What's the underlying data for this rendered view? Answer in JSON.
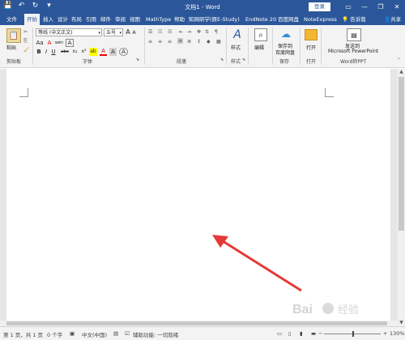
{
  "window": {
    "title": "文档1 - Word",
    "login_label": "登录",
    "minimize": "—",
    "restore": "❐",
    "close": "✕"
  },
  "qat": {
    "save_icon": "💾",
    "undo_icon": "↶",
    "redo_icon": "↻",
    "more_icon": "▾"
  },
  "tabs": [
    {
      "label": "文件"
    },
    {
      "label": "开始"
    },
    {
      "label": "插入"
    },
    {
      "label": "设计"
    },
    {
      "label": "布局"
    },
    {
      "label": "引用"
    },
    {
      "label": "邮件"
    },
    {
      "label": "审阅"
    },
    {
      "label": "视图"
    },
    {
      "label": "MathType"
    },
    {
      "label": "帮助"
    },
    {
      "label": "知网研学(原E-Study)"
    },
    {
      "label": "EndNote 20"
    },
    {
      "label": "百度网盘"
    },
    {
      "label": "NoteExpress"
    }
  ],
  "tellme": "告诉我",
  "share": "共享",
  "ribbon": {
    "clipboard": {
      "paste": "粘贴",
      "label": "剪贴板"
    },
    "font": {
      "font_name": "等线 (中文正文)",
      "font_size": "五号",
      "label": "字体",
      "grow": "A",
      "shrink": "A",
      "aa": "Aa",
      "clear": "A",
      "wen": "wén",
      "A_box": "A",
      "bold": "B",
      "italic": "I",
      "underline": "U",
      "strike": "abc",
      "sub": "x₂",
      "sup": "x²",
      "highlight": "ab",
      "font_color": "A",
      "shade": "A",
      "encircle": "A"
    },
    "paragraph": {
      "label": "段落"
    },
    "styles": {
      "btn": "样式",
      "label": "样式"
    },
    "editing": {
      "btn": "编辑"
    },
    "save": {
      "btn_line1": "保存到",
      "btn_line2": "百度网盘",
      "label": "保存"
    },
    "open": {
      "btn": "打开",
      "label": "打开"
    },
    "ppt": {
      "btn_line1": "发送到",
      "btn_line2": "Microsoft PowerPoint",
      "label": "Word转PPT"
    }
  },
  "status": {
    "page": "第 1 页，共 1 页",
    "words": "0 个字",
    "lang": "中文(中国)",
    "accessibility": "辅助功能: 一切就绪",
    "zoom_minus": "−",
    "zoom_plus": "+",
    "zoom_level": "130%"
  },
  "watermark": {
    "text": "Bai 经验"
  }
}
